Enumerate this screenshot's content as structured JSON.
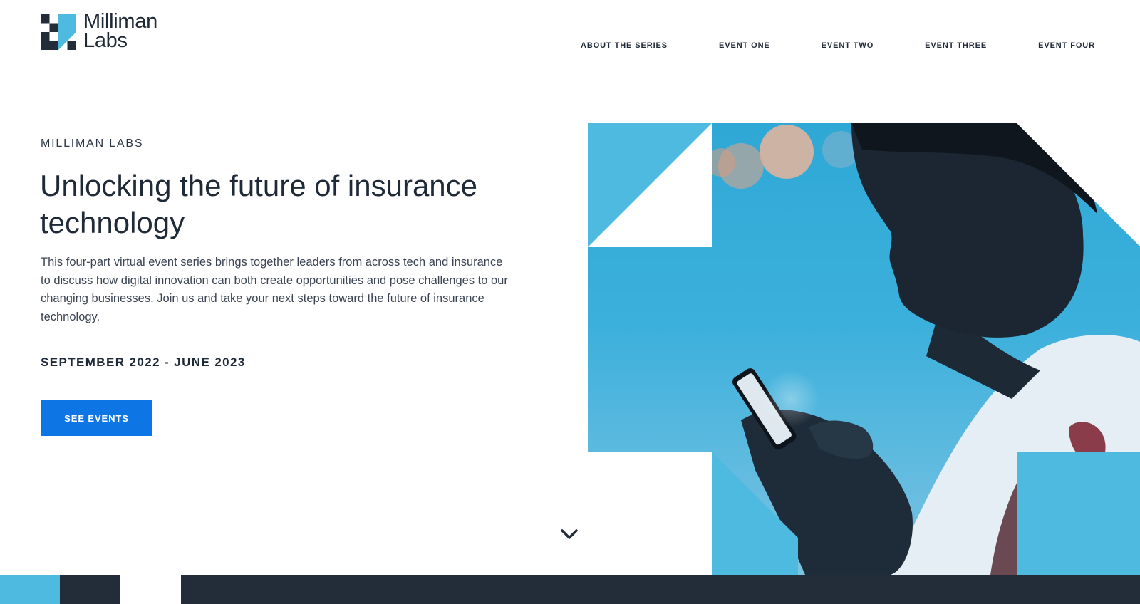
{
  "brand": {
    "name_line1": "Milliman",
    "name_line2": "Labs",
    "logo_icon": "milliman-checker-logo-icon"
  },
  "nav": {
    "items": [
      {
        "label": "ABOUT THE SERIES"
      },
      {
        "label": "EVENT ONE"
      },
      {
        "label": "EVENT TWO"
      },
      {
        "label": "EVENT THREE"
      },
      {
        "label": "EVENT FOUR"
      }
    ]
  },
  "hero": {
    "eyebrow": "MILLIMAN LABS",
    "title": "Unlocking the future of insurance technology",
    "description": "This four-part virtual event series brings together leaders from across tech and insurance to discuss how digital innovation can both create opportunities and pose challenges to our changing businesses. Join us and take your next steps toward the future of insurance technology.",
    "dates": "SEPTEMBER 2022 - JUNE 2023",
    "cta_label": "SEE EVENTS",
    "scroll_icon": "chevron-down-icon",
    "image_description_icon": "person-with-phone-photo"
  },
  "colors": {
    "dark_navy": "#232c39",
    "accent_blue": "#4ebae0",
    "cta_blue": "#0e75e4",
    "text": "#1f2a38"
  }
}
